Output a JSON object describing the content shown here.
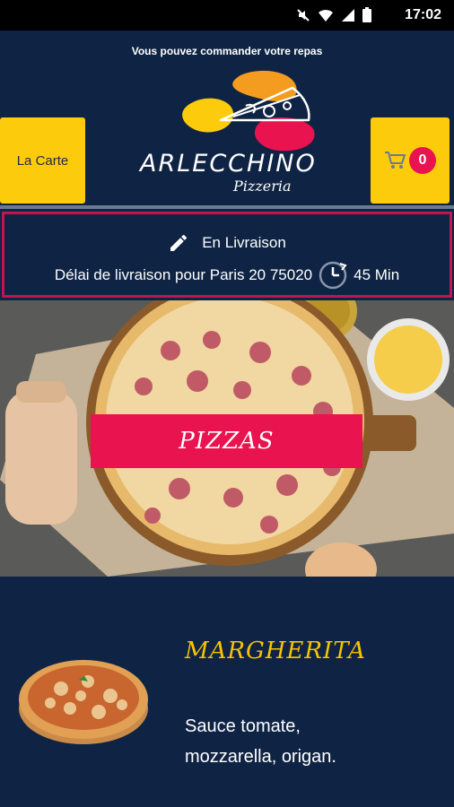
{
  "status_bar": {
    "time": "17:02",
    "icons": [
      "mute-icon",
      "wifi-icon",
      "signal-icon",
      "battery-icon"
    ]
  },
  "header": {
    "notice": "Vous pouvez commander votre repas",
    "menu_button_label": "La Carte",
    "cart_count": "0",
    "logo_title": "ARLECCHINO",
    "logo_subtitle": "Pizzeria"
  },
  "delivery": {
    "mode": "En Livraison",
    "info": "Délai de livraison pour Paris 20 75020",
    "duration": "45 Min"
  },
  "category": {
    "banner_label": "PIZZAS"
  },
  "product": {
    "name": "MARGHERITA",
    "description": "Sauce tomate, mozzarella, origan."
  },
  "colors": {
    "background": "#0f2444",
    "accent_yellow": "#fccc0c",
    "accent_pink": "#e8134f",
    "product_title": "#f7c400"
  }
}
